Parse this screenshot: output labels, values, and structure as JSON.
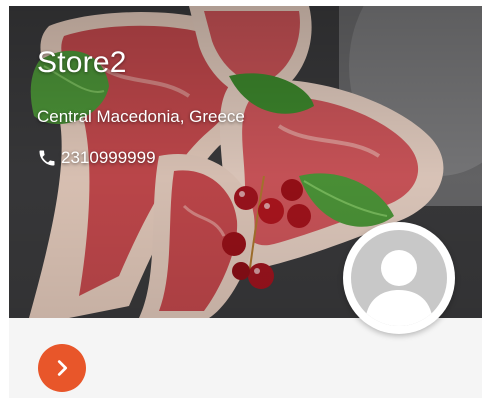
{
  "store": {
    "name": "Store2",
    "location": "Central Macedonia, Greece",
    "phone": "2310999999"
  },
  "icons": {
    "phone": "phone-icon",
    "avatar": "user-avatar-icon",
    "go": "chevron-right-icon"
  },
  "colors": {
    "accent": "#e8562a",
    "footer_background": "#f5f5f5",
    "avatar_placeholder": "#c8c8c8"
  }
}
